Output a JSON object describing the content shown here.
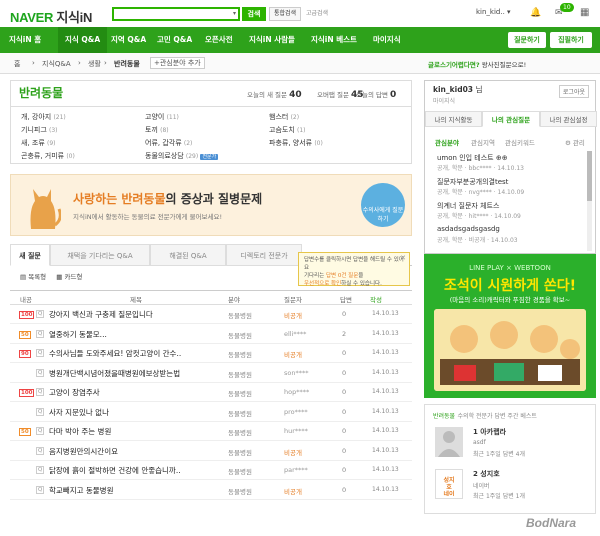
{
  "header": {
    "logo_naver": "NAVER",
    "logo_kin": "지식iN",
    "search_placeholder": "",
    "search_btn": "검색",
    "search_btn2": "통합검색",
    "advanced": "고급검색",
    "user": "kin_kid..",
    "badge": "10"
  },
  "nav": [
    "지식iN 홈",
    "지식 Q&A",
    "지역 Q&A",
    "고민 Q&A",
    "오픈사전",
    "지식iN 사람들",
    "지식iN 베스트",
    "마이지식"
  ],
  "actions": {
    "ask": "질문하기",
    "join": "집필하기"
  },
  "breadcrumb": [
    "홈",
    "지식Q&A",
    "생활",
    "반려동물",
    "+관심분야 추가"
  ],
  "line_notice": {
    "strong": "글로스기어렵다면?",
    "rest": "왕사진질문으로!"
  },
  "category": {
    "title": "반려동물",
    "today_label": "오늘의 새 질문",
    "today": "40",
    "answer_label": "오버탭 질문",
    "answer": "45",
    "answer_today_label": "오늘의 답변",
    "answer_today": "0"
  },
  "subcats": [
    {
      "name": "개, 강아지",
      "count": "(21)"
    },
    {
      "name": "고양이",
      "count": "(11)"
    },
    {
      "name": "햄스터",
      "count": "(2)"
    },
    {
      "name": "기니피그",
      "count": "(3)"
    },
    {
      "name": "토끼",
      "count": "(8)"
    },
    {
      "name": "고슴도치",
      "count": "(1)"
    },
    {
      "name": "새, 조류",
      "count": "(9)"
    },
    {
      "name": "어류, 갑각류",
      "count": "(2)"
    },
    {
      "name": "파충류, 양서류",
      "count": "(0)"
    },
    {
      "name": "곤충류, 거미류",
      "count": "(0)"
    },
    {
      "name": "동물의료상담",
      "count": "(29)"
    }
  ],
  "subcat_tag": "전문가",
  "promo": {
    "title_hl": "사랑하는 반려동물",
    "title_rest": "의 증상과 질병문제",
    "sub": "지식iN에서 활동하는 동물의료 전문가에게 물어보세요!",
    "circle": "수의사에게 질문하기"
  },
  "tabs": [
    "새 질문",
    "채택을 기다리는 Q&A",
    "해결된 Q&A",
    "디렉토리 전문가"
  ],
  "tip": {
    "l1": "답변수를 클릭하시면 답변을 해드릴 수 있어요",
    "l2a": "기다리는",
    "l2b": "답변 0건 질문",
    "l2c": "을",
    "l3a": "우선적으로 확인",
    "l3b": "하실 수 있습니다."
  },
  "view": {
    "list": "목록형",
    "card": "카드형"
  },
  "thead": {
    "num": "내공",
    "title": "제목",
    "cat": "분야",
    "author": "질문자",
    "ans": "답변",
    "date": "작성"
  },
  "rows": [
    {
      "n": "100",
      "title": "강아지 백신과 구충제 질문입니다",
      "cat": "동물병원",
      "au": "비공개",
      "an": "0",
      "dt": "14.10.13"
    },
    {
      "n": "50",
      "title": "열중하기 동물모...",
      "cat": "동물병원",
      "au": "elli****",
      "an": "2",
      "dt": "14.10.13"
    },
    {
      "n": "90",
      "title": "수의사님들 도와주세요! 암컷고양이 간수..",
      "cat": "동물병원",
      "au": "비공개",
      "an": "0",
      "dt": "14.10.13"
    },
    {
      "n": "",
      "title": "병원개단백시념어졌을때병원에보상받는법",
      "cat": "동물병원",
      "au": "son****",
      "an": "0",
      "dt": "14.10.13"
    },
    {
      "n": "100",
      "title": "고양이 장염주사",
      "cat": "동물병원",
      "au": "hop****",
      "an": "0",
      "dt": "14.10.13"
    },
    {
      "n": "",
      "title": "사자 지문있나 없나",
      "cat": "동물병원",
      "au": "pro****",
      "an": "0",
      "dt": "14.10.13"
    },
    {
      "n": "50",
      "title": "다마 박아 주는 병원",
      "cat": "동물병원",
      "au": "hur****",
      "an": "0",
      "dt": "14.10.13"
    },
    {
      "n": "",
      "title": "음지병원만의시간이요",
      "cat": "동물병원",
      "au": "비공개",
      "an": "0",
      "dt": "14.10.13"
    },
    {
      "n": "",
      "title": "닭장에 흙이 절박하면 건강에 안좋습니까..",
      "cat": "동물병원",
      "au": "par****",
      "an": "0",
      "dt": "14.10.13"
    },
    {
      "n": "",
      "title": "학교빼지고 동물병원",
      "cat": "동물병원",
      "au": "비공개",
      "an": "0",
      "dt": "14.10.13"
    }
  ],
  "right": {
    "user": "kin_kid03",
    "user_suffix": "님",
    "grade": "마이지식",
    "logout": "로그아웃",
    "tabs": [
      "나의 지식활동",
      "나의 관심질문",
      "나의 관심설정"
    ],
    "subs": [
      "관심분야",
      "관심지역",
      "관심키워드"
    ],
    "manage": "관리",
    "qs": [
      {
        "t": "umon 인입 테스트 ⊕⊕",
        "m": "공개, 학문 · bbc**** · 14.10.13"
      },
      {
        "t": "질문자부분공개의결test",
        "m": "공개, 학문 · nvg**** · 14.10.09"
      },
      {
        "t": "의계너 질문자 체트스",
        "m": "공개, 학문 · hit**** · 14.10.09"
      },
      {
        "t": "asdadsgadsgasdg",
        "m": "공개, 학문 · 비공개 · 14.10.03"
      }
    ]
  },
  "ad": {
    "t1": "LINE PLAY × WEBTOON",
    "t2a": "조석",
    "t2b": "이 시원하게 쏜다!",
    "t3": "(마음의 소리)캐릭터와 푸짐한 경품을 확보~"
  },
  "experts": {
    "title": "반려동물",
    "sub": "수의학 전문가 답변 주간 베스트",
    "items": [
      {
        "rank": "1 아카랩라",
        "name": "asdf",
        "meta": "최근 1주일 답변 4개"
      },
      {
        "rank": "2 성지호",
        "name": "네이버",
        "meta": "최근 1주일 답변 1개"
      }
    ]
  },
  "watermark": "BodNara"
}
